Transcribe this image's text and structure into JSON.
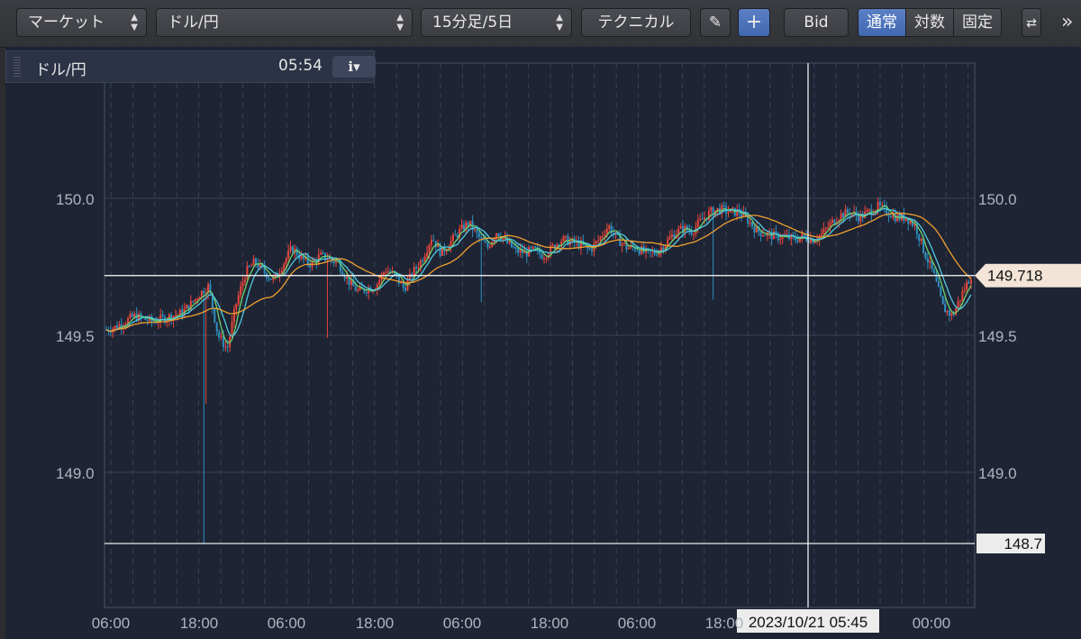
{
  "toolbar": {
    "market_select": "マーケット",
    "pair_select": "ドル/円",
    "period_select": "15分足/5日",
    "technical_button": "テクニカル",
    "bid_button": "Bid",
    "scale_modes": [
      "通常",
      "対数",
      "固定"
    ],
    "active_scale_mode": "通常",
    "more_icon": "»"
  },
  "info_panel": {
    "pair": "ドル/円",
    "time": "05:54",
    "info_icon": "ℹ▾"
  },
  "crosshair": {
    "date_label": "2023/10/21 05:45",
    "price_label": "148.7"
  },
  "current_price_label": "149.718",
  "colors": {
    "background": "#1e2433",
    "grid": "#3a4256",
    "candle_up": "#e8463c",
    "candle_down": "#2f8fc0",
    "ma_short": "#6ed36e",
    "ma_mid": "#4ec9e0",
    "ma_long": "#f0a030",
    "crosshair": "#ffffff"
  },
  "chart_data": {
    "type": "candlestick",
    "pair": "ドル/円",
    "timeframe": "15分足/5日",
    "ylim": [
      148.33,
      150.5
    ],
    "y_ticks": [
      "150.0",
      "149.5",
      "149.0"
    ],
    "x_ticks": [
      "06:00",
      "18:00",
      "06:00",
      "18:00",
      "06:00",
      "18:00",
      "06:00",
      "18:00",
      "06:00",
      "18:00",
      "00:00"
    ],
    "series_close": [
      149.52,
      149.53,
      149.55,
      149.57,
      149.56,
      149.55,
      149.56,
      149.57,
      149.58,
      149.61,
      149.65,
      149.68,
      149.5,
      149.45,
      149.62,
      149.73,
      149.77,
      149.73,
      149.7,
      149.76,
      149.82,
      149.78,
      149.76,
      149.79,
      149.78,
      149.76,
      149.7,
      149.66,
      149.67,
      149.68,
      149.74,
      149.72,
      149.67,
      149.73,
      149.78,
      149.86,
      149.8,
      149.84,
      149.88,
      149.91,
      149.86,
      149.82,
      149.88,
      149.84,
      149.81,
      149.8,
      149.81,
      149.79,
      149.82,
      149.85,
      149.84,
      149.83,
      149.81,
      149.85,
      149.9,
      149.85,
      149.82,
      149.82,
      149.8,
      149.8,
      149.83,
      149.87,
      149.89,
      149.88,
      149.92,
      149.95,
      149.96,
      149.95,
      149.95,
      149.92,
      149.88,
      149.87,
      149.86,
      149.86,
      149.85,
      149.86,
      149.85,
      149.87,
      149.91,
      149.94,
      149.95,
      149.93,
      149.95,
      149.97,
      149.95,
      149.93,
      149.93,
      149.9,
      149.8,
      149.72,
      149.6,
      149.57,
      149.65,
      149.718
    ],
    "ma_short_last": 149.7,
    "ma_long_last": 149.72,
    "last_price": 149.718,
    "low_spike": 148.74
  }
}
